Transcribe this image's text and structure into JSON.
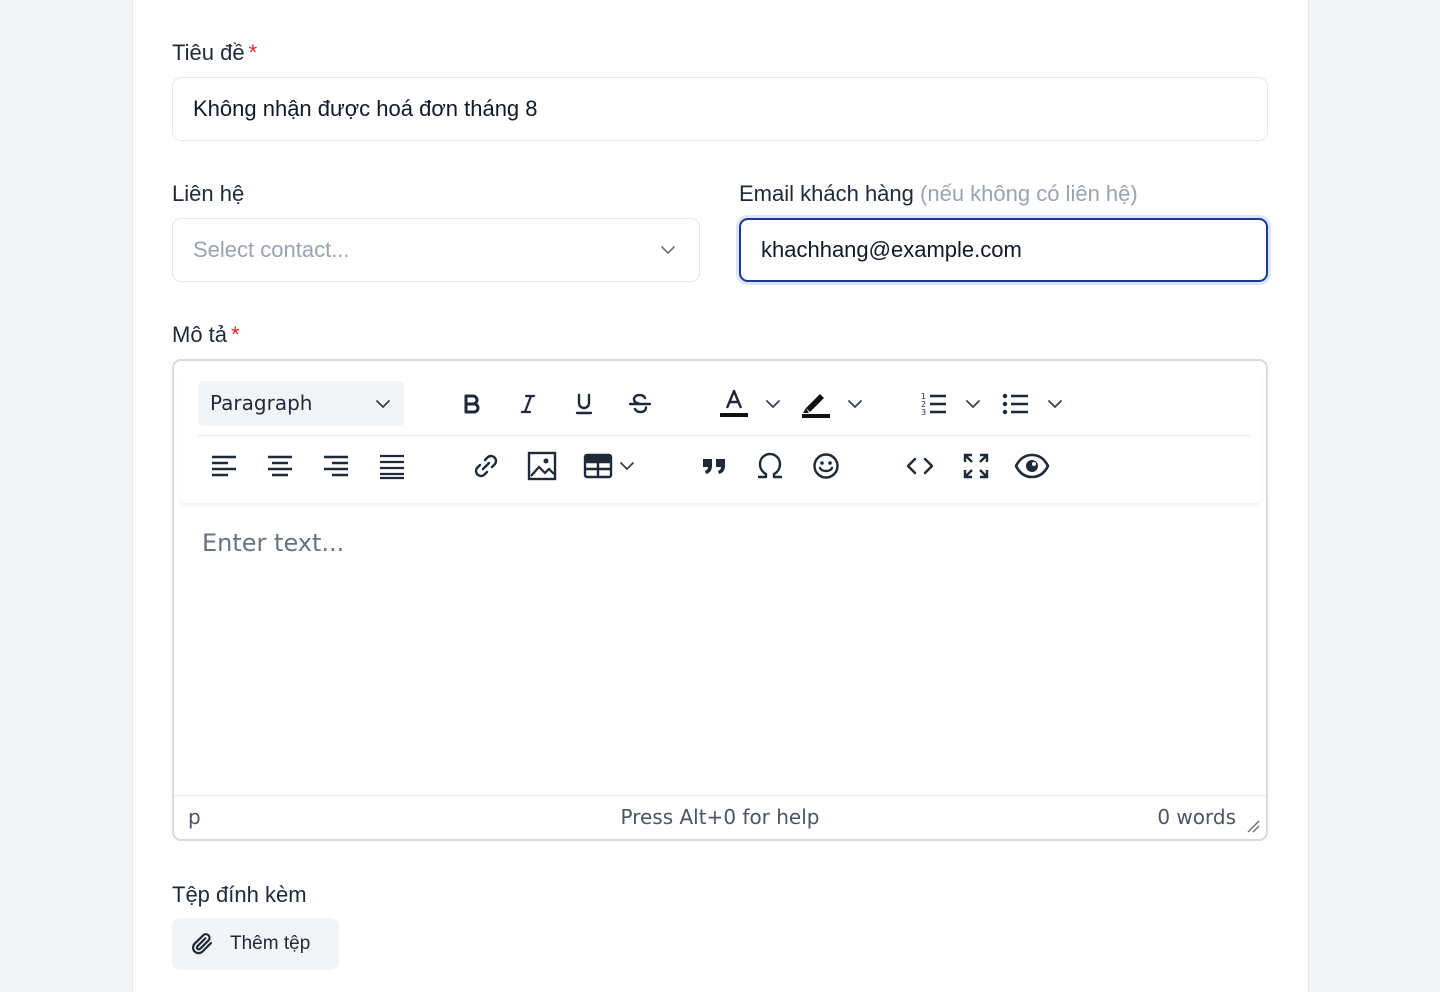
{
  "form": {
    "title": {
      "label": "Tiêu đề",
      "required_mark": "*",
      "value": "Không nhận được hoá đơn tháng 8"
    },
    "contact": {
      "label": "Liên hệ",
      "placeholder": "Select contact..."
    },
    "email": {
      "label": "Email khách hàng",
      "hint": "(nếu không có liên hệ)",
      "value": "khachhang@example.com"
    },
    "description": {
      "label": "Mô tả",
      "required_mark": "*",
      "editor": {
        "block_format": "Paragraph",
        "placeholder": "Enter text...",
        "status_path": "p",
        "status_help": "Press Alt+0 for help",
        "word_count": "0 words",
        "toolbar_icons": [
          "bold-icon",
          "italic-icon",
          "underline-icon",
          "strikethrough-icon",
          "text-color-icon",
          "highlight-icon",
          "numbered-list-icon",
          "bullet-list-icon",
          "align-left-icon",
          "align-center-icon",
          "align-right-icon",
          "align-justify-icon",
          "link-icon",
          "image-icon",
          "table-icon",
          "quote-icon",
          "omega-icon",
          "emoji-icon",
          "code-icon",
          "fullscreen-icon",
          "preview-icon"
        ]
      }
    },
    "attachments": {
      "label": "Tệp đính kèm",
      "button_label": "Thêm tệp"
    }
  },
  "colors": {
    "required": "#dc2626",
    "focus_border": "#1e3a8a",
    "muted_text": "#9ca3af"
  }
}
